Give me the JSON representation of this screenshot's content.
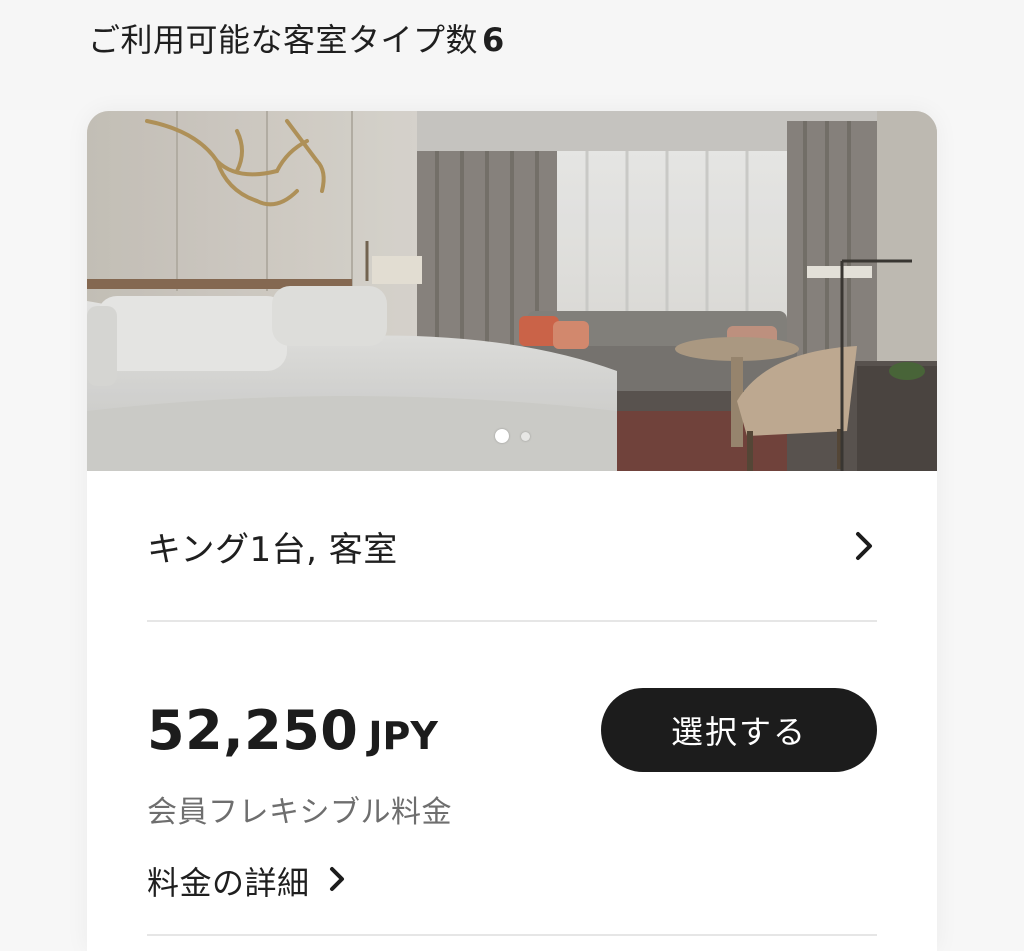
{
  "header": {
    "title": "ご利用可能な客室タイプ数",
    "count": "6"
  },
  "room": {
    "photo_alt": "",
    "carousel": {
      "total": 2,
      "active": 1
    },
    "name": "キング1台, 客室",
    "rate": {
      "amount": "52,250",
      "currency": "JPY",
      "select_label": "選択する",
      "name": "会員フレキシブル料金",
      "details_label": "料金の詳細"
    }
  },
  "icons": {
    "room_chevron": "chevron-right-icon",
    "details_chevron": "chevron-right-icon"
  },
  "colors": {
    "button_bg": "#1c1c1c",
    "button_text": "#ffffff",
    "secondary_text": "#6e6e6e"
  }
}
